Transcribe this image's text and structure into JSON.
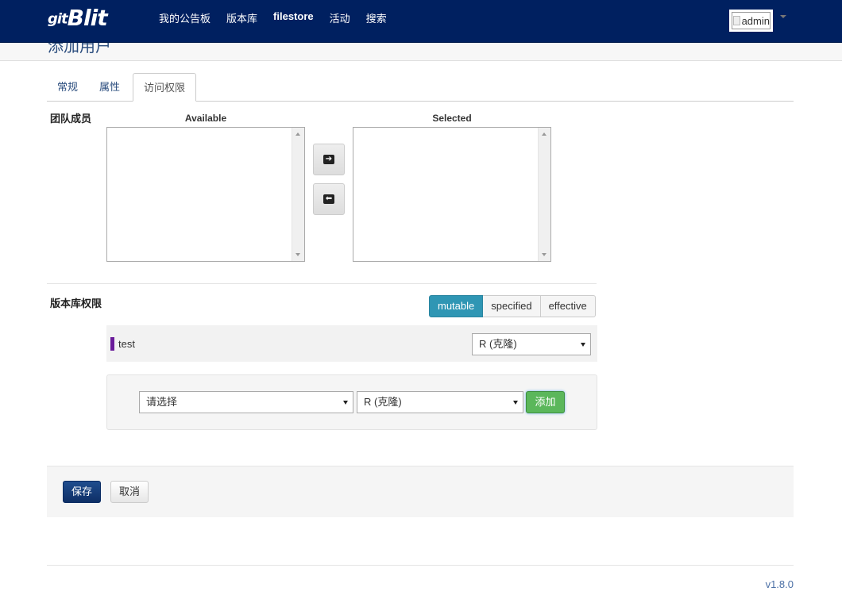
{
  "brand": {
    "prefix": "git",
    "name": "Blit"
  },
  "nav": [
    "我的公告板",
    "版本库",
    "filestore",
    "活动",
    "搜索"
  ],
  "user": {
    "alt": "admin"
  },
  "page_title": "添加用户",
  "tabs": [
    "常规",
    "属性",
    "访问权限"
  ],
  "active_tab": "访问权限",
  "team_section": {
    "label": "团队成员",
    "available_title": "Available",
    "selected_title": "Selected",
    "available_items": [],
    "selected_items": []
  },
  "repo_section": {
    "label": "版本库权限",
    "view_modes": [
      "mutable",
      "specified",
      "effective"
    ],
    "active_view_mode": "mutable",
    "permissions": [
      {
        "repo": "test",
        "permission": "R (克隆)",
        "marker_color": "#6a1b9a"
      }
    ],
    "add_form": {
      "repo_select": "请选择",
      "permission_select": "R (克隆)",
      "add_label": "添加"
    }
  },
  "actions": {
    "save": "保存",
    "cancel": "取消"
  },
  "version": "v1.8.0",
  "colors": {
    "navbar": "#002060",
    "accent": "#2f96b4",
    "add": "#5bb75b",
    "save": "#1f4d8e"
  },
  "icons": {
    "move_right": "arrow-right-icon",
    "move_left": "arrow-left-icon"
  }
}
